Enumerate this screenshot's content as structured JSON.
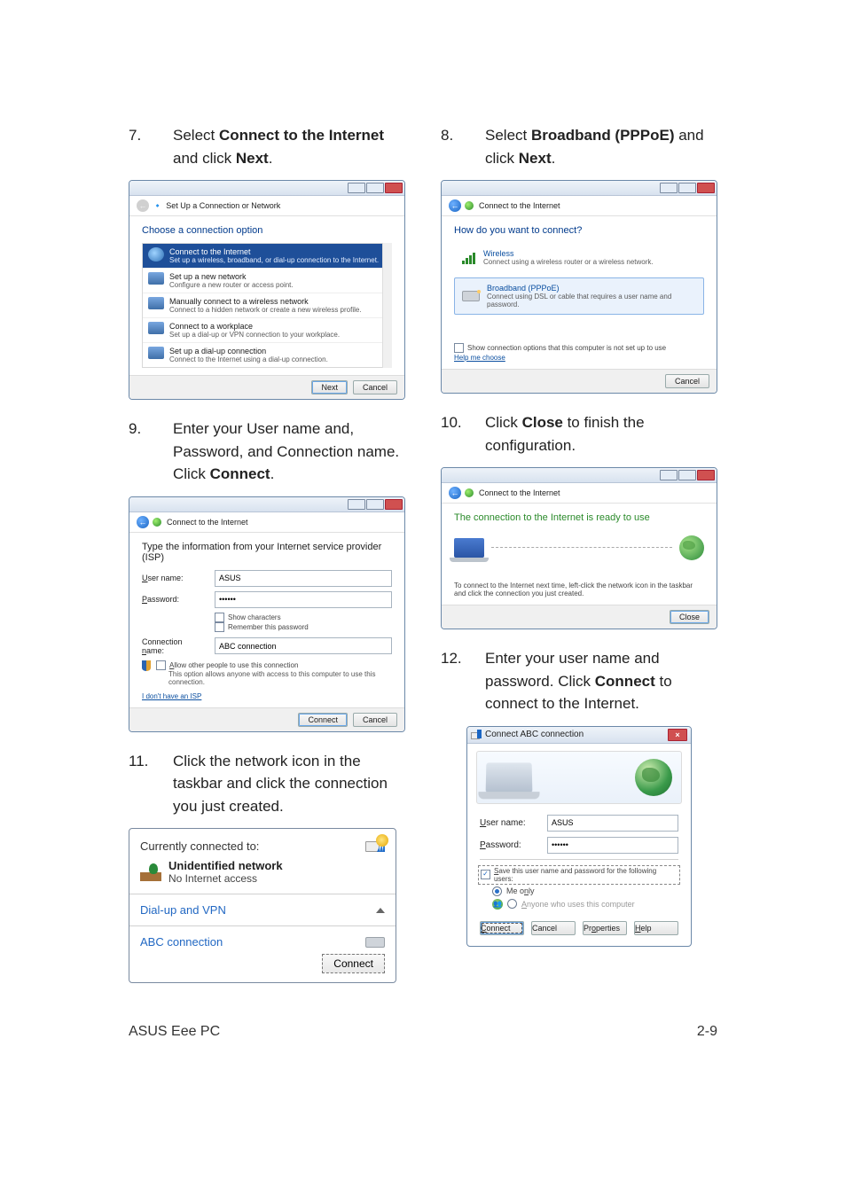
{
  "steps": {
    "s7": {
      "num": "7.",
      "pre": "Select ",
      "bold": "Connect to the Internet",
      "mid": " and click ",
      "bold2": "Next",
      "post": "."
    },
    "s8": {
      "num": "8.",
      "pre": "Select ",
      "bold": "Broadband (PPPoE)",
      "mid": " and click ",
      "bold2": "Next",
      "post": "."
    },
    "s9": {
      "num": "9.",
      "text": "Enter your User name and, Password, and Connection name. Click ",
      "bold": "Connect",
      "post": "."
    },
    "s10": {
      "num": "10.",
      "pre": "Click ",
      "bold": "Close",
      "post": " to finish the configuration."
    },
    "s11": {
      "num": "11.",
      "text": "Click the network icon in the taskbar and click the connection you just created."
    },
    "s12": {
      "num": "12.",
      "text": "Enter your user name and password. Click ",
      "bold": "Connect",
      "post": " to connect to the Internet."
    }
  },
  "win7": {
    "nav_title": "Set Up a Connection or Network",
    "heading": "Choose a connection option",
    "options": [
      {
        "title": "Connect to the Internet",
        "sub": "Set up a wireless, broadband, or dial-up connection to the Internet."
      },
      {
        "title": "Set up a new network",
        "sub": "Configure a new router or access point."
      },
      {
        "title": "Manually connect to a wireless network",
        "sub": "Connect to a hidden network or create a new wireless profile."
      },
      {
        "title": "Connect to a workplace",
        "sub": "Set up a dial-up or VPN connection to your workplace."
      },
      {
        "title": "Set up a dial-up connection",
        "sub": "Connect to the Internet using a dial-up connection."
      }
    ],
    "next": "Next",
    "cancel": "Cancel"
  },
  "win8": {
    "nav_title": "Connect to the Internet",
    "heading": "How do you want to connect?",
    "wireless": {
      "title": "Wireless",
      "sub": "Connect using a wireless router or a wireless network."
    },
    "pppoe": {
      "title": "Broadband (PPPoE)",
      "sub": "Connect using DSL or cable that requires a user name and password."
    },
    "show_more": "Show connection options that this computer is not set up to use",
    "help": "Help me choose",
    "cancel": "Cancel"
  },
  "win9": {
    "nav_title": "Connect to the Internet",
    "heading": "Type the information from your Internet service provider (ISP)",
    "user_label": "User name:",
    "user_value": "ASUS",
    "pass_label": "Password:",
    "pass_value": "••••••",
    "show_chars": "Show characters",
    "remember": "Remember this password",
    "conn_label": "Connection name:",
    "conn_value": "ABC connection",
    "allow": "Allow other people to use this connection",
    "allow_sub": "This option allows anyone with access to this computer to use this connection.",
    "no_isp": "I don't have an ISP",
    "connect": "Connect",
    "cancel": "Cancel"
  },
  "win10": {
    "nav_title": "Connect to the Internet",
    "heading": "The connection to the Internet is ready to use",
    "hint": "To connect to the Internet next time, left-click the network icon in the taskbar and click the connection you just created.",
    "close": "Close"
  },
  "fly": {
    "currently": "Currently connected to:",
    "unid": "Unidentified network",
    "no_access": "No Internet access",
    "dialup": "Dial-up and VPN",
    "abc": "ABC connection",
    "connect": "Connect"
  },
  "dlg12": {
    "title": "Connect ABC connection",
    "user_label": "User name:",
    "user_value": "ASUS",
    "pass_label": "Password:",
    "pass_value": "••••••",
    "save": "Save this user name and password for the following users:",
    "me_only": "Me only",
    "anyone": "Anyone who uses this computer",
    "connect": "Connect",
    "cancel": "Cancel",
    "properties": "Properties",
    "help": "Help"
  },
  "footer": {
    "left": "ASUS Eee PC",
    "right": "2-9"
  }
}
